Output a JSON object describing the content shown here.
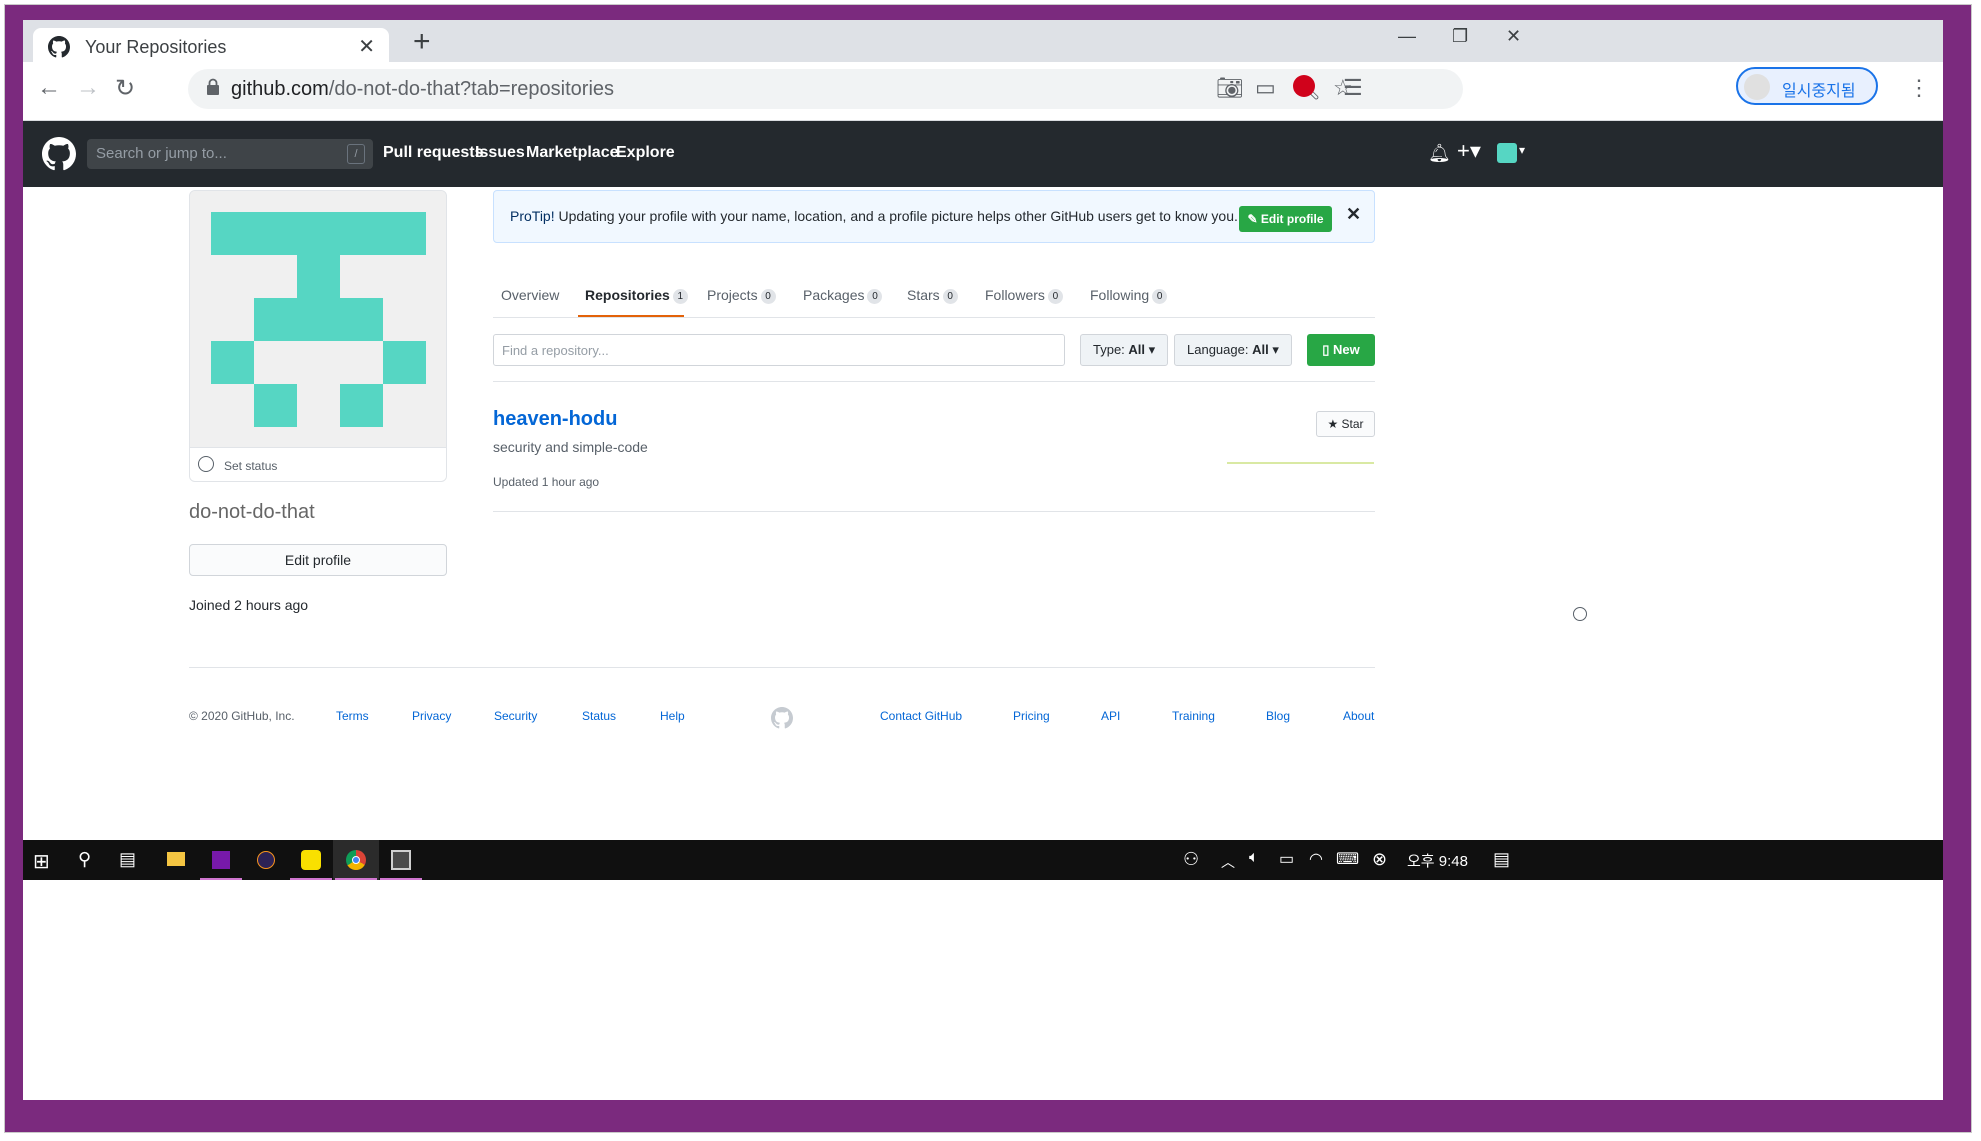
{
  "browser": {
    "tab_title": "Your Repositories",
    "url_host": "github.com",
    "url_path": "/do-not-do-that?tab=repositories",
    "profile_label": "일시중지됨"
  },
  "github": {
    "search_placeholder": "Search or jump to...",
    "search_shortcut": "/",
    "nav": [
      "Pull requests",
      "Issues",
      "Marketplace",
      "Explore"
    ]
  },
  "profile": {
    "set_status": "Set status",
    "username": "do-not-do-that",
    "edit_profile": "Edit profile",
    "joined": "Joined 2 hours ago",
    "avatar_color": "#56d6c3"
  },
  "protip": {
    "lead": "ProTip!",
    "text": " Updating your profile with your name, location, and a profile picture helps other GitHub users get to know you.",
    "button": "Edit profile"
  },
  "tabs": [
    {
      "label": "Overview",
      "count": null
    },
    {
      "label": "Repositories",
      "count": "1"
    },
    {
      "label": "Projects",
      "count": "0"
    },
    {
      "label": "Packages",
      "count": "0"
    },
    {
      "label": "Stars",
      "count": "0"
    },
    {
      "label": "Followers",
      "count": "0"
    },
    {
      "label": "Following",
      "count": "0"
    }
  ],
  "filters": {
    "find_placeholder": "Find a repository...",
    "type_label": "Type:",
    "type_value": "All",
    "language_label": "Language:",
    "language_value": "All",
    "new_button": "New"
  },
  "repo": {
    "name": "heaven-hodu",
    "description": "security and simple-code",
    "updated": "Updated 1 hour ago",
    "star": "Star"
  },
  "footer": {
    "copyright": "© 2020 GitHub, Inc.",
    "left_links": [
      "Terms",
      "Privacy",
      "Security",
      "Status",
      "Help"
    ],
    "right_links": [
      "Contact GitHub",
      "Pricing",
      "API",
      "Training",
      "Blog",
      "About"
    ]
  },
  "taskbar": {
    "time": "오후 9:48"
  }
}
